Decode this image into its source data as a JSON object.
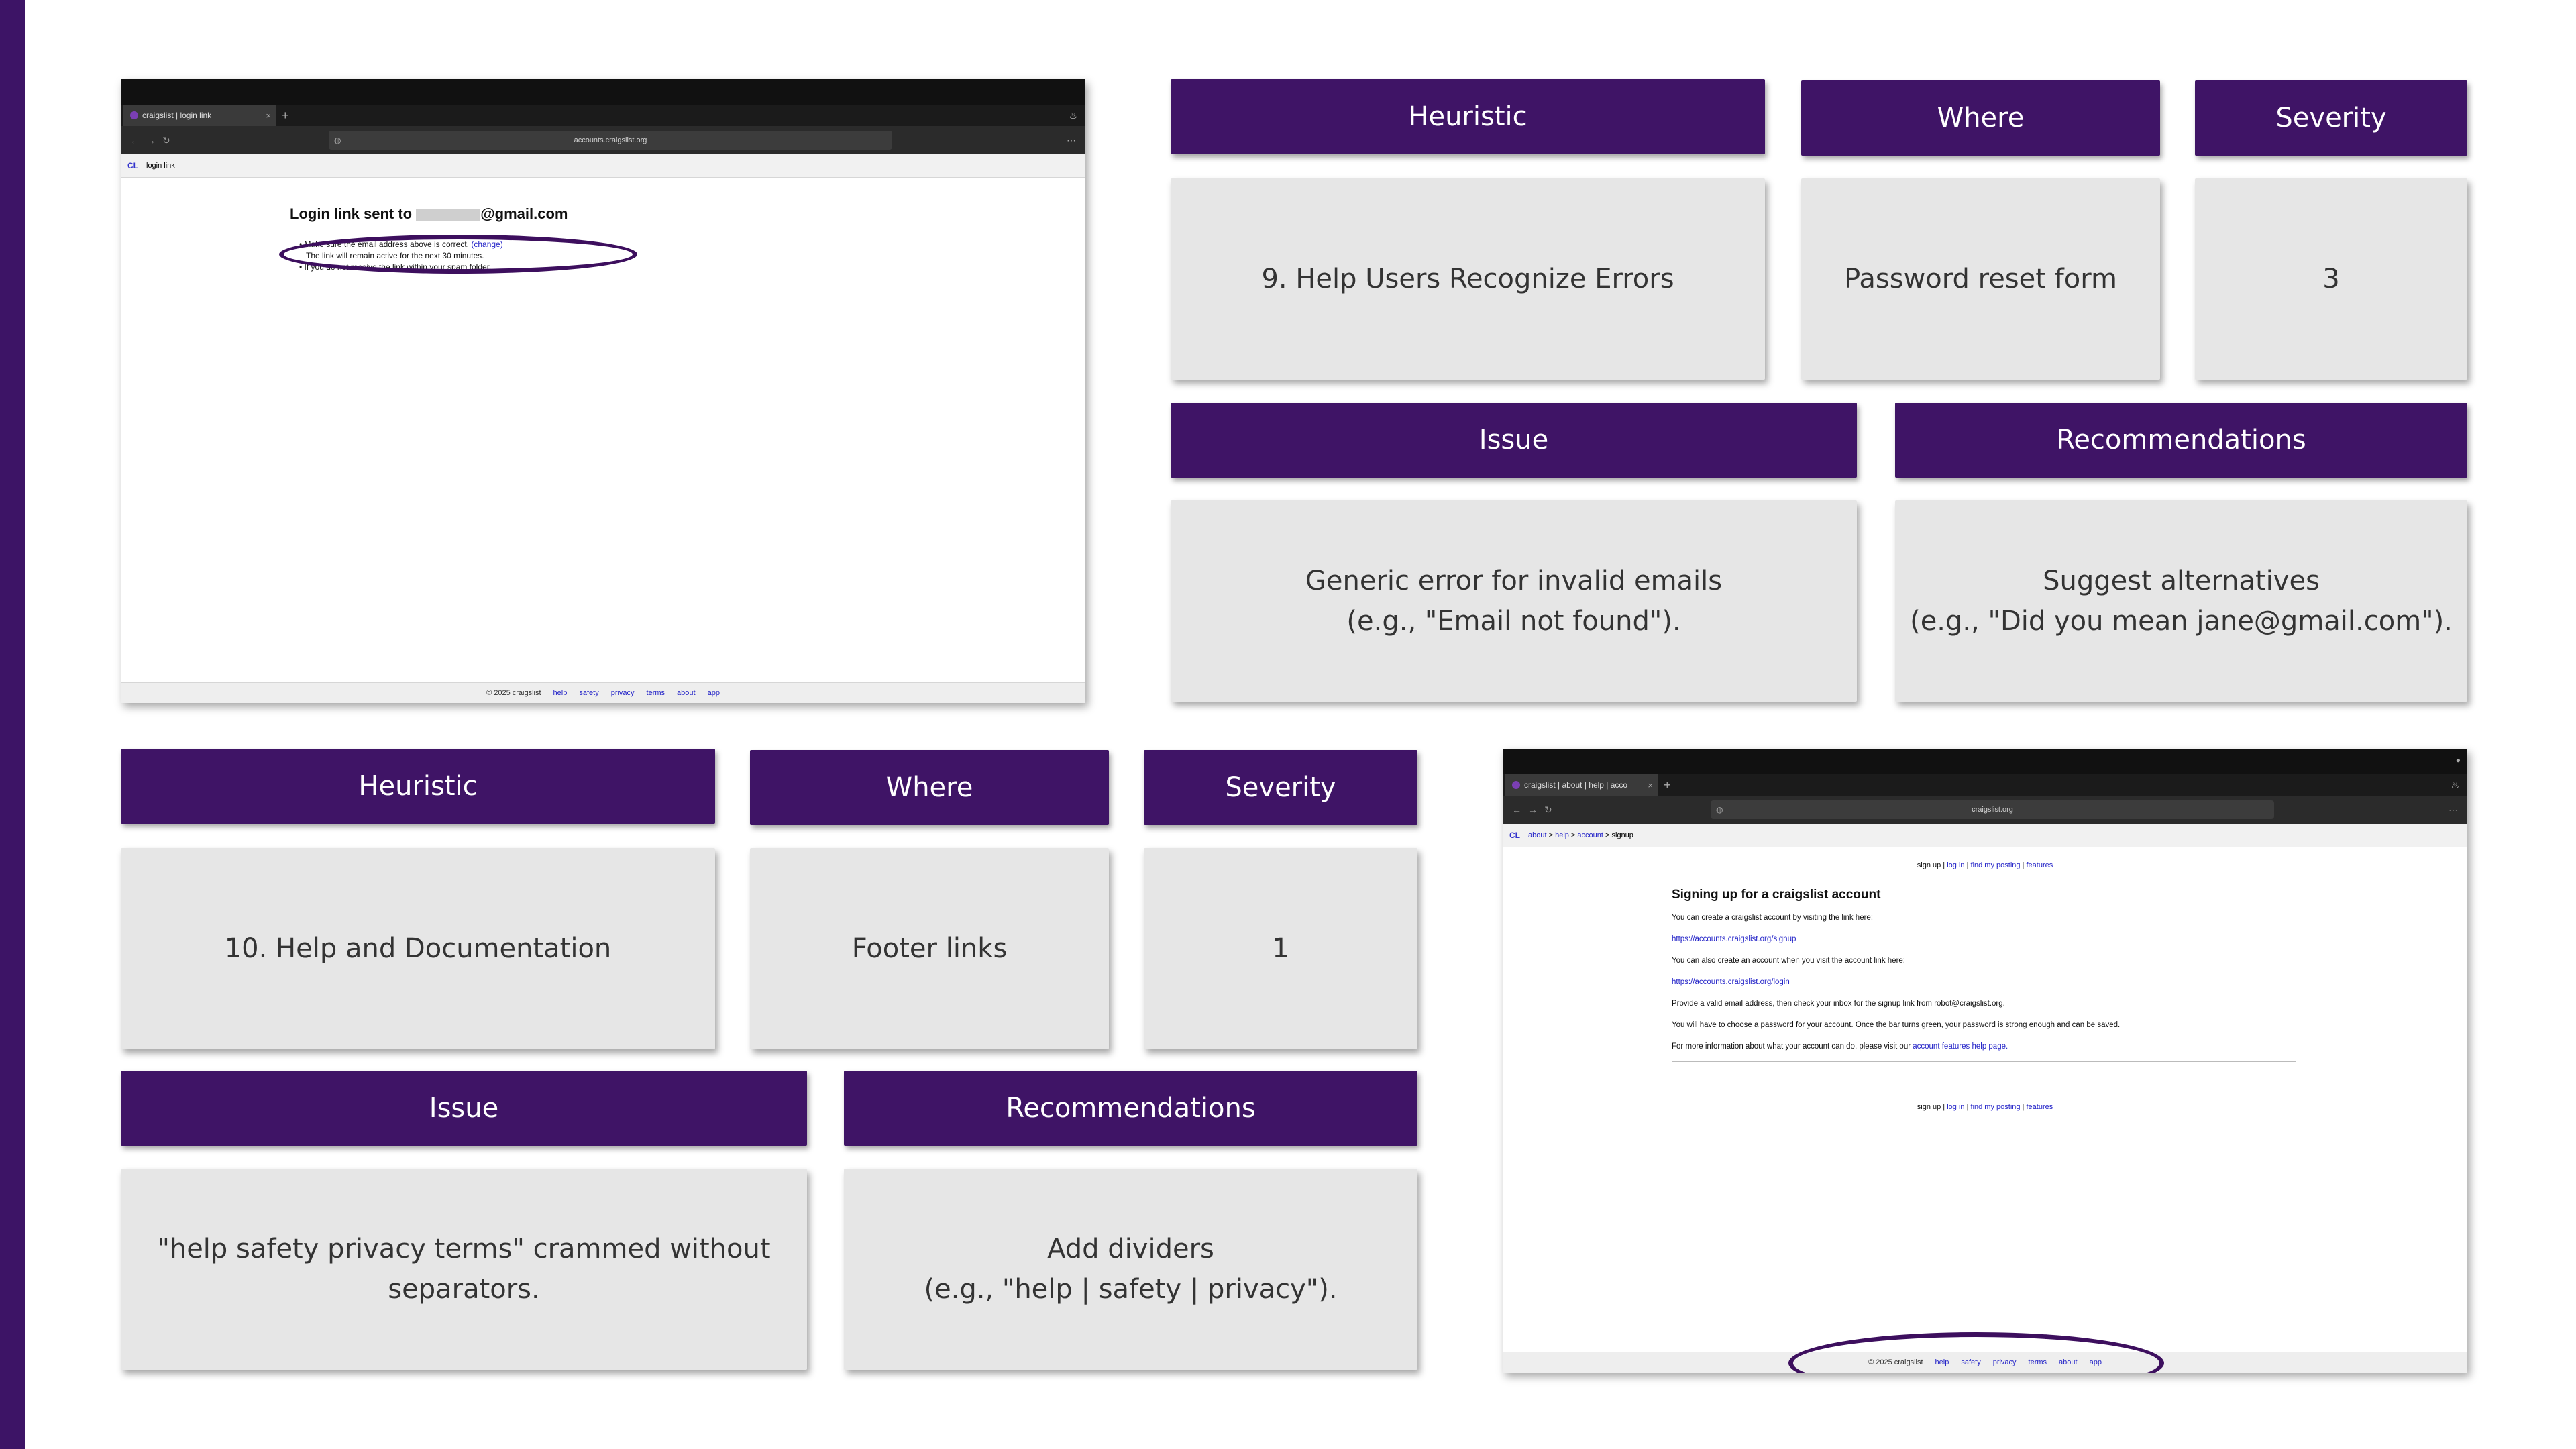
{
  "slide": {
    "top_heuristic_header": "Heuristic",
    "top_where_header": "Where",
    "top_severity_header": "Severity",
    "top_heuristic_value": "9. Help Users Recognize Errors",
    "top_where_value": "Password reset form",
    "top_severity_value": "3",
    "top_issue_header": "Issue",
    "top_recommendations_header": "Recommendations",
    "top_issue_line1": "Generic error for invalid emails",
    "top_issue_line2": "(e.g., \"Email not found\").",
    "top_rec_line1": "Suggest alternatives",
    "top_rec_line2": "(e.g., \"Did you mean jane@gmail.com\").",
    "bottom_heuristic_header": "Heuristic",
    "bottom_where_header": "Where",
    "bottom_severity_header": "Severity",
    "bottom_heuristic_value": "10. Help and Documentation",
    "bottom_where_value": "Footer links",
    "bottom_severity_value": "1",
    "bottom_issue_header": "Issue",
    "bottom_recommendations_header": "Recommendations",
    "bottom_issue_line1": "\"help safety privacy terms\" crammed without",
    "bottom_issue_line2": "separators.",
    "bottom_rec_line1": "Add dividers",
    "bottom_rec_line2": "(e.g., \"help | safety | privacy\")."
  },
  "shot1": {
    "tab_title": "craigslist | login link",
    "tab_close": "×",
    "new_tab": "+",
    "url": "accounts.craigslist.org",
    "crumb_logo": "CL",
    "crumb_text": "login link",
    "heading_prefix": "Login link sent to",
    "heading_suffix": "@gmail.com",
    "bullet1": "Make sure the email address above is correct.",
    "bullet1_link": "(change)",
    "bullet2": "The link will remain active for the next 30 minutes.",
    "bullet3": "If you do not receive the link within your spam folder.",
    "footer_copy": "© 2025 craigslist",
    "footer_links": [
      "help",
      "safety",
      "privacy",
      "terms",
      "about",
      "app"
    ]
  },
  "shot2": {
    "tab_title": "craigslist | about | help | acco",
    "tab_close": "×",
    "new_tab": "+",
    "url": "craigslist.org",
    "crumb_logo": "CL",
    "crumb_about": "about",
    "crumb_help": "help",
    "crumb_account": "account",
    "crumb_signup": "signup",
    "nav_signup": "sign up",
    "nav_login": "log in",
    "nav_find": "find my posting",
    "nav_features": "features",
    "heading": "Signing up for a craigslist account",
    "p1": "You can create a craigslist account by visiting the link here:",
    "link1": "https://accounts.craigslist.org/signup",
    "p2": "You can also create an account when you visit the account link here:",
    "link2": "https://accounts.craigslist.org/login",
    "p3": "Provide a valid email address, then check your inbox for the signup link from robot@craigslist.org.",
    "p4": "You will have to choose a password for your account. Once the bar turns green, your password is strong enough and can be saved.",
    "p5_prefix": "For more information about what your account can do, please visit our",
    "p5_link": "account features help page.",
    "footer_copy": "© 2025 craigslist",
    "footer_links": [
      "help",
      "safety",
      "privacy",
      "terms",
      "about",
      "app"
    ]
  },
  "colors": {
    "accent_purple": "#3f1466",
    "card_gray": "#e6e6e6",
    "link_blue": "#2424c8"
  }
}
